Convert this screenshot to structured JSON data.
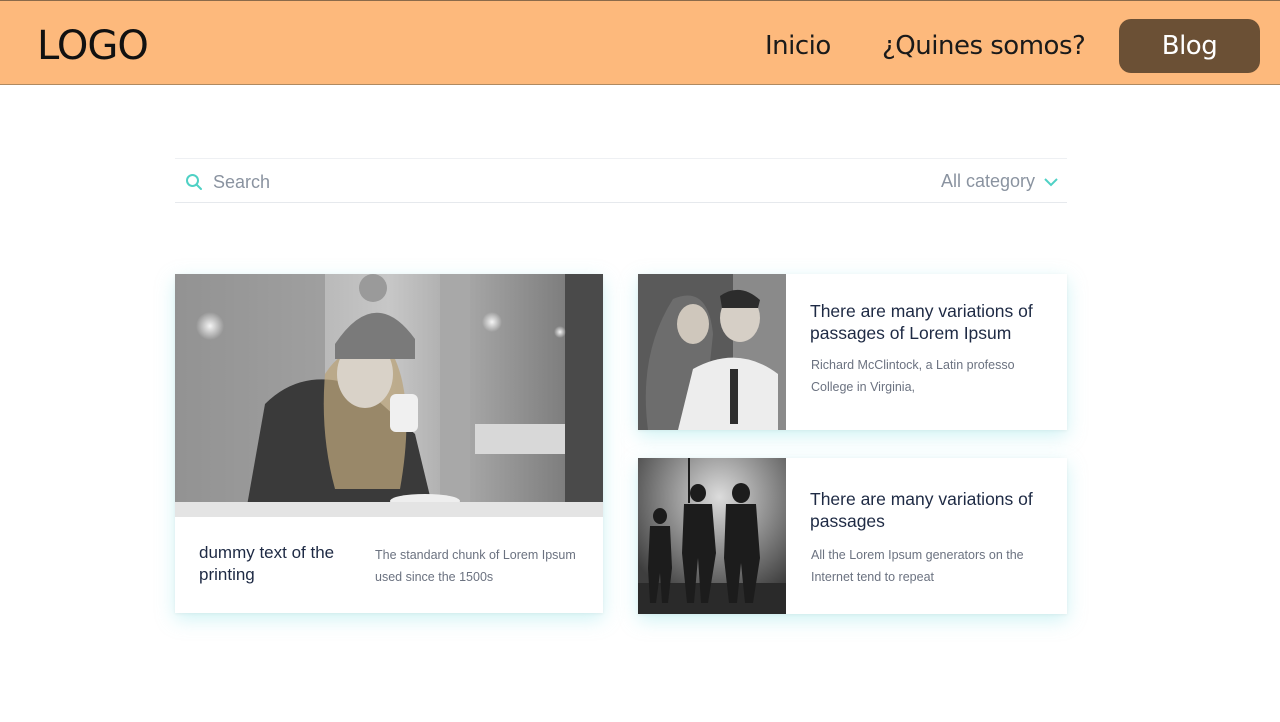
{
  "header": {
    "logo": "LOGO",
    "nav": {
      "inicio": "Inicio",
      "quienes": "¿Quines somos?",
      "blog": "Blog"
    },
    "background": "#fdb97c",
    "active_button_color": "#6b5035"
  },
  "search": {
    "placeholder": "Search",
    "category": "All category",
    "icon": "search-icon",
    "accent": "#4fd1c5"
  },
  "cards": {
    "featured": {
      "title": "dummy text of the printing",
      "description": "The standard chunk of Lorem Ipsum used since the 1500s",
      "image": "woman-drinking-coffee-photo"
    },
    "side": [
      {
        "title": "There are many variations of passages of Lorem Ipsum",
        "description": "Richard McClintock, a Latin professo College in Virginia,",
        "image": "couple-embracing-photo"
      },
      {
        "title": "There are many variations of passages",
        "description": "All the Lorem Ipsum generators on the Internet tend to repeat",
        "image": "figures-in-smoke-photo"
      }
    ]
  }
}
